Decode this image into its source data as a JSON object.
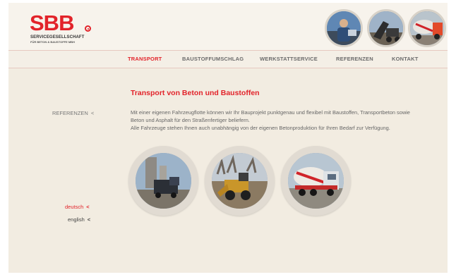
{
  "logo": {
    "main": "SBB",
    "sub1": "SERVICEGESELLSCHAFT",
    "sub2": "FÜR BETON & BAUSTOFFE MBH"
  },
  "nav": {
    "items": [
      {
        "label": "TRANSPORT",
        "active": true
      },
      {
        "label": "BAUSTOFFUMSCHLAG",
        "active": false
      },
      {
        "label": "WERKSTATTSERVICE",
        "active": false
      },
      {
        "label": "REFERENZEN",
        "active": false
      },
      {
        "label": "KONTAKT",
        "active": false
      }
    ]
  },
  "content": {
    "title": "Transport von Beton und Baustoffen",
    "lines": [
      "Mit einer eigenen Fahrzeugflotte können wir Ihr Bauprojekt punktgenau und flexibel mit Baustoffen, Transportbeton sowie",
      "Beton und Asphalt für den Straßenfertiger beliefern.",
      "Alle Fahrzeuge stehen Ihnen auch unabhängig von der eigenen Betonproduktion für Ihren Bedarf zur Verfügung."
    ]
  },
  "sidebar": {
    "referenzen": "REFERENZEN",
    "lang_de": "deutsch",
    "lang_en": "english",
    "arrow": "<"
  },
  "colors": {
    "brand_red": "#e2232a",
    "background": "#f2ece1"
  },
  "icons": [
    "header-photo-worker",
    "header-photo-loader",
    "header-photo-mixer",
    "photo-truck-silo",
    "photo-wheel-loader",
    "photo-concrete-mixer"
  ]
}
